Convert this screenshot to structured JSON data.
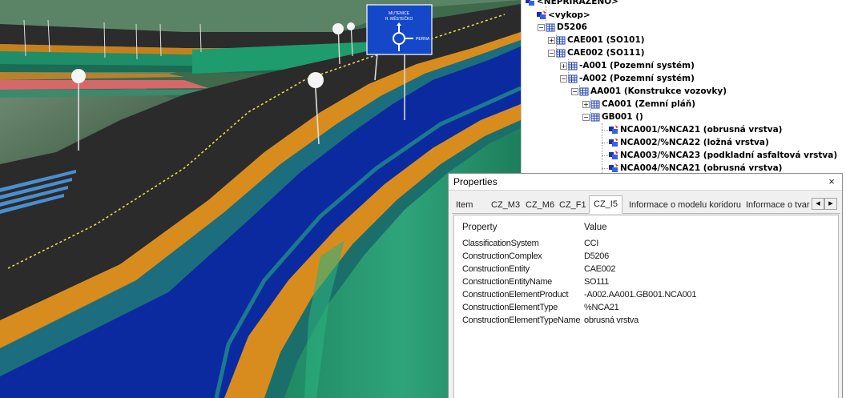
{
  "viewport": {
    "road_sign": {
      "line1": "MUTENICE",
      "line2": "H. MĚSTEČKO",
      "arrow_label": "PERNA"
    }
  },
  "tree": {
    "nodes": [
      {
        "label": "<NEPRIRAZENO>",
        "expander": "",
        "icon": "leaf-icon"
      },
      {
        "label": "<vykop>",
        "expander": "",
        "icon": "leaf-icon"
      },
      {
        "label": "D5206",
        "expander": "−",
        "icon": "folder-grid-icon"
      },
      {
        "label": "CAE001 (SO101)",
        "expander": "+",
        "icon": "folder-grid-icon"
      },
      {
        "label": "CAE002 (SO111)",
        "expander": "−",
        "icon": "folder-grid-icon"
      },
      {
        "label": "-A001 (Pozemní systém)",
        "expander": "+",
        "icon": "folder-grid-icon"
      },
      {
        "label": "-A002 (Pozemní systém)",
        "expander": "−",
        "icon": "folder-grid-icon"
      },
      {
        "label": "AA001 (Konstrukce vozovky)",
        "expander": "−",
        "icon": "folder-grid-icon"
      },
      {
        "label": "CA001 (Zemní pláň)",
        "expander": "+",
        "icon": "folder-grid-icon"
      },
      {
        "label": "GB001 ()",
        "expander": "−",
        "icon": "folder-grid-icon"
      },
      {
        "label": "NCA001/%NCA21 (obrusná vrstva)",
        "expander": "",
        "icon": "leaf-icon"
      },
      {
        "label": "NCA002/%NCA22 (ložná vrstva)",
        "expander": "",
        "icon": "leaf-icon"
      },
      {
        "label": "NCA003/%NCA23 (podkladní asfaltová vrstva)",
        "expander": "",
        "icon": "leaf-icon"
      },
      {
        "label": "NCA004/%NCA21 (obrusná vrstva)",
        "expander": "",
        "icon": "leaf-icon"
      }
    ]
  },
  "properties": {
    "title": "Properties",
    "close_glyph": "×",
    "tabs": [
      "Item",
      "CZ_M3",
      "CZ_M6",
      "CZ_F1",
      "CZ_I5",
      "Informace o modelu koridoru",
      "Informace o tvar"
    ],
    "active_tab": "CZ_I5",
    "scroll_left": "◀",
    "scroll_right": "▶",
    "columns": {
      "property": "Property",
      "value": "Value"
    },
    "rows": [
      {
        "property": "ClassificationSystem",
        "value": "CCI"
      },
      {
        "property": "ConstructionComplex",
        "value": "D5206"
      },
      {
        "property": "ConstructionEntity",
        "value": "CAE002"
      },
      {
        "property": "ConstructionEntityName",
        "value": "SO111"
      },
      {
        "property": "ConstructionElementProduct",
        "value": "-A002.AA001.GB001.NCA001"
      },
      {
        "property": "ConstructionElementType",
        "value": "%NCA21"
      },
      {
        "property": "ConstructionElementTypeName",
        "value": "obrusná vrstva"
      }
    ]
  },
  "colors": {
    "road_surface": "#0b2aa0",
    "shoulder_orange": "#d68a1c",
    "embankment_green": "#2f9a74",
    "asphalt_dark": "#2e2e2e",
    "sign_blue": "#1548c9",
    "selection_panel_bg": "#f0f0f0"
  }
}
